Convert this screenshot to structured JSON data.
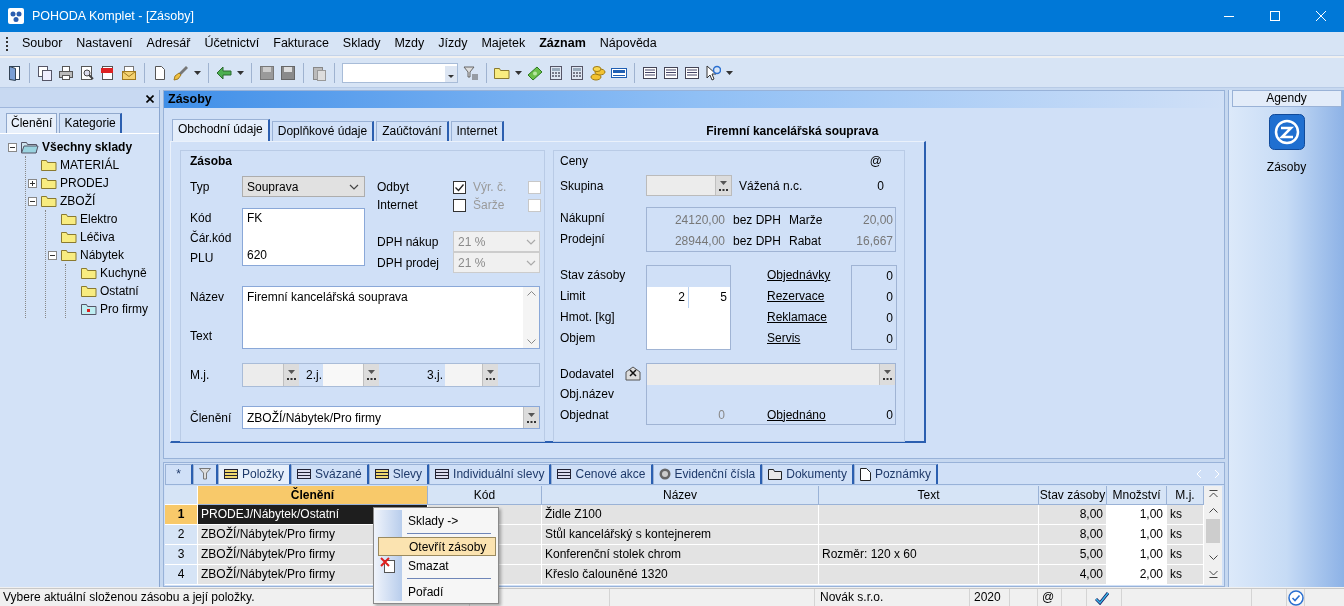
{
  "window": {
    "title": "POHODA Komplet - [Zásoby]"
  },
  "menu": [
    {
      "label": "Soubor",
      "bold": false
    },
    {
      "label": "Nastavení",
      "bold": false
    },
    {
      "label": "Adresář",
      "bold": false
    },
    {
      "label": "Účetnictví",
      "bold": false
    },
    {
      "label": "Fakturace",
      "bold": false
    },
    {
      "label": "Sklady",
      "bold": false
    },
    {
      "label": "Mzdy",
      "bold": false
    },
    {
      "label": "Jízdy",
      "bold": false
    },
    {
      "label": "Majetek",
      "bold": false
    },
    {
      "label": "Záznam",
      "bold": true
    },
    {
      "label": "Nápověda",
      "bold": false
    }
  ],
  "navigator": {
    "tabs": [
      {
        "label": "Členění",
        "selected": true
      },
      {
        "label": "Kategorie",
        "selected": false
      }
    ],
    "tree": [
      {
        "label": "Všechny sklady",
        "kind": "root",
        "expanded": true,
        "selected": false,
        "children": [
          {
            "label": "MATERIÁL",
            "kind": "folder",
            "selected": false
          },
          {
            "label": "PRODEJ",
            "kind": "folder",
            "expanded": false,
            "selected": false
          },
          {
            "label": "ZBOŽÍ",
            "kind": "folder",
            "expanded": true,
            "selected": false,
            "children": [
              {
                "label": "Elektro",
                "kind": "folder",
                "selected": false
              },
              {
                "label": "Léčiva",
                "kind": "folder",
                "selected": false
              },
              {
                "label": "Nábytek",
                "kind": "folder",
                "expanded": true,
                "selected": false,
                "children": [
                  {
                    "label": "Kuchyně",
                    "kind": "folder",
                    "selected": false
                  },
                  {
                    "label": "Ostatní",
                    "kind": "folder",
                    "selected": false
                  },
                  {
                    "label": "Pro firmy",
                    "kind": "folder",
                    "selected": true
                  }
                ]
              }
            ]
          }
        ]
      }
    ]
  },
  "agenda": {
    "title": "Zásoby",
    "tabs": [
      {
        "label": "Obchodní údaje",
        "selected": true
      },
      {
        "label": "Doplňkové údaje",
        "selected": false
      },
      {
        "label": "Zaúčtování",
        "selected": false
      },
      {
        "label": "Internet",
        "selected": false
      }
    ],
    "record_title": "Firemní kancelářská souprava",
    "zasoba": {
      "heading": "Zásoba",
      "typ": {
        "label": "Typ",
        "value": "Souprava"
      },
      "codes": [
        {
          "label": "Kód",
          "value": "FK"
        },
        {
          "label": "Čár.kód"
        },
        {
          "label": "PLU",
          "value": "620"
        }
      ],
      "flags": [
        {
          "label": "Odbyt",
          "checked": true,
          "disabled": false
        },
        {
          "label": "Výr. č.",
          "checked": false,
          "disabled": true
        },
        {
          "label": "Internet",
          "checked": false,
          "disabled": false
        },
        {
          "label": "Šarže",
          "checked": false,
          "disabled": true
        }
      ],
      "dph": [
        {
          "label": "DPH nákup",
          "value": "21 %"
        },
        {
          "label": "DPH prodej",
          "value": "21 %"
        }
      ],
      "nazev": {
        "label": "Název",
        "value": "Firemní kancelářská souprava"
      },
      "text": {
        "label": "Text"
      },
      "units": [
        {
          "label": "M.j."
        },
        {
          "label": "2.j."
        },
        {
          "label": "3.j."
        }
      ],
      "cleneni": {
        "label": "Členění",
        "value": "ZBOŽÍ/Nábytek/Pro firmy"
      }
    },
    "ceny": {
      "heading": "Ceny",
      "at": "@",
      "skupina": {
        "label": "Skupina"
      },
      "vazena": {
        "label": "Vážená n.c.",
        "value": "0"
      },
      "prices": [
        {
          "label": "Nákupní",
          "value": "24120,00",
          "suffix": "bez DPH",
          "extra_label": "Marže",
          "extra_value": "20,00"
        },
        {
          "label": "Prodejní",
          "value": "28944,00",
          "suffix": "bez DPH",
          "extra_label": "Rabat",
          "extra_value": "16,667"
        }
      ],
      "stock_labels": [
        "Stav zásoby",
        "Limit",
        "Hmot. [kg]",
        "Objem"
      ],
      "limit": [
        "2",
        "5"
      ],
      "links": [
        {
          "label": "Objednávky",
          "value": "0"
        },
        {
          "label": "Rezervace",
          "value": "0"
        },
        {
          "label": "Reklamace",
          "value": "0"
        },
        {
          "label": "Servis",
          "value": "0"
        }
      ],
      "dodavatel": {
        "label": "Dodavatel"
      },
      "obj_nazev": {
        "label": "Obj.název"
      },
      "objednat": {
        "label": "Objednat",
        "value": "0"
      },
      "objednano": {
        "label": "Objednáno",
        "value": "0"
      }
    }
  },
  "detail": {
    "tabs": [
      {
        "kind": "star",
        "label": "*",
        "selected": false
      },
      {
        "kind": "filter",
        "selected": false
      },
      {
        "kind": "table",
        "label": "Položky",
        "selected": true
      },
      {
        "kind": "table",
        "label": "Svázané",
        "selected": false
      },
      {
        "kind": "table",
        "label": "Slevy",
        "selected": false
      },
      {
        "kind": "table",
        "label": "Individuální slevy",
        "selected": false
      },
      {
        "kind": "table",
        "label": "Cenové akce",
        "selected": false
      },
      {
        "kind": "disc",
        "label": "Evidenční čísla",
        "selected": false
      },
      {
        "kind": "folder",
        "label": "Dokumenty",
        "selected": false
      },
      {
        "kind": "page",
        "label": "Poznámky",
        "selected": false
      }
    ],
    "columns": [
      {
        "label": "Členění",
        "sorted": true
      },
      {
        "label": "Kód",
        "sorted": false
      },
      {
        "label": "Název",
        "sorted": false
      },
      {
        "label": "Text",
        "sorted": false
      },
      {
        "label": "Stav zásoby",
        "sorted": false
      },
      {
        "label": "Množství",
        "sorted": false
      },
      {
        "label": "M.j.",
        "sorted": false
      }
    ],
    "rows": [
      {
        "number": "1",
        "cleneni": "PRODEJ/Nábytek/Ostatní",
        "nazev": "Židle Z100",
        "stav": "8,00",
        "mnozstvi": "1,00",
        "mj": "ks",
        "selected": true
      },
      {
        "number": "2",
        "cleneni": "ZBOŽÍ/Nábytek/Pro firmy",
        "nazev": "Stůl kancelářský s kontejnerem",
        "stav": "8,00",
        "mnozstvi": "1,00",
        "mj": "ks",
        "selected": false
      },
      {
        "number": "3",
        "cleneni": "ZBOŽÍ/Nábytek/Pro firmy",
        "nazev": "Konferenční stolek chrom",
        "text": "Rozměr: 120 x 60",
        "stav": "5,00",
        "mnozstvi": "1,00",
        "mj": "ks",
        "selected": false
      },
      {
        "number": "4",
        "cleneni": "ZBOŽÍ/Nábytek/Pro firmy",
        "nazev": "Křeslo čalouněné 1320",
        "stav": "4,00",
        "mnozstvi": "2,00",
        "mj": "ks",
        "selected": false
      }
    ]
  },
  "context_menu": [
    {
      "kind": "item",
      "label": "Sklady ->",
      "highlighted": false,
      "icon": false
    },
    {
      "kind": "separator"
    },
    {
      "kind": "item",
      "label": "Otevřít zásoby",
      "highlighted": true,
      "icon": false
    },
    {
      "kind": "item",
      "label": "Smazat",
      "highlighted": false,
      "icon": true
    },
    {
      "kind": "separator"
    },
    {
      "kind": "item",
      "label": "Pořadí",
      "highlighted": false,
      "icon": false
    }
  ],
  "agendy_panel": {
    "title": "Agendy",
    "items": [
      {
        "label": "Zásoby"
      }
    ]
  },
  "status_bar": {
    "hint": "Vybere aktuální složenou zásobu a její položky.",
    "company": "Novák s.r.o.",
    "year": "2020",
    "email": "@"
  }
}
